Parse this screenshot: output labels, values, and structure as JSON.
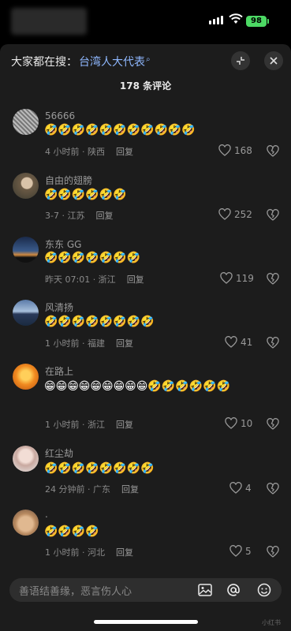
{
  "status": {
    "battery": "98"
  },
  "header": {
    "search_prefix": "大家都在搜：",
    "search_term": "台湾人大代表",
    "comment_count": "178 条评论"
  },
  "colors": {
    "sheet_bg": "#1c1c1c",
    "search_term": "#8fb8ff",
    "battery": "#4cd964"
  },
  "comments": [
    {
      "name": "56666",
      "body": "🤣🤣🤣🤣🤣🤣🤣🤣🤣🤣🤣",
      "time": "4 小时前 · 陕西",
      "reply": "回复",
      "likes": "168"
    },
    {
      "name": "自由的翅膀",
      "body": "🤣🤣🤣🤣🤣🤣",
      "time": "3-7 · 江苏",
      "reply": "回复",
      "likes": "252"
    },
    {
      "name": "东东 GG",
      "body": "🤣🤣🤣🤣🤣🤣🤣",
      "time": "昨天 07:01 · 浙江",
      "reply": "回复",
      "likes": "119"
    },
    {
      "name": "风清扬",
      "body": "🤣🤣🤣🤣🤣🤣🤣🤣",
      "time": "1 小时前 · 福建",
      "reply": "回复",
      "likes": "41"
    },
    {
      "name": "在路上",
      "body": "😁😁😁😁😁😁😁😁😁🤣🤣🤣🤣🤣🤣",
      "time": "1 小时前 · 浙江",
      "reply": "回复",
      "likes": "10"
    },
    {
      "name": "红尘劫",
      "body": "🤣🤣🤣🤣🤣🤣🤣🤣",
      "time": "24 分钟前 · 广东",
      "reply": "回复",
      "likes": "4"
    },
    {
      "name": ".",
      "body": "🤣🤣🤣🤣",
      "time": "1 小时前 · 河北",
      "reply": "回复",
      "likes": "5"
    }
  ],
  "input": {
    "placeholder": "善语结善缘，恶言伤人心"
  },
  "watermark": "小红书"
}
